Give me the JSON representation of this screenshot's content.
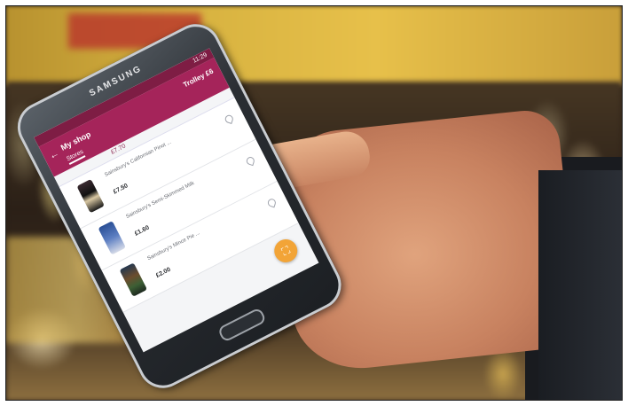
{
  "phone": {
    "brand": "SAMSUNG",
    "status_time": "11:29",
    "app": {
      "title": "My shop",
      "total": "Trolley £6",
      "tab": "Stores",
      "subtotal": "£7.70",
      "items": [
        {
          "name": "Sainsbury's Californian Pinot ...",
          "price": "£7.50"
        },
        {
          "name": "Sainsbury's Semi-Skimmed Milk",
          "price": "£1.60"
        },
        {
          "name": "Sainsbury's Mince Pie ...",
          "price": "£2.00"
        }
      ],
      "fab_icon": "scan-icon"
    }
  },
  "colors": {
    "app_primary": "#a5245a",
    "fab": "#f2a437"
  }
}
